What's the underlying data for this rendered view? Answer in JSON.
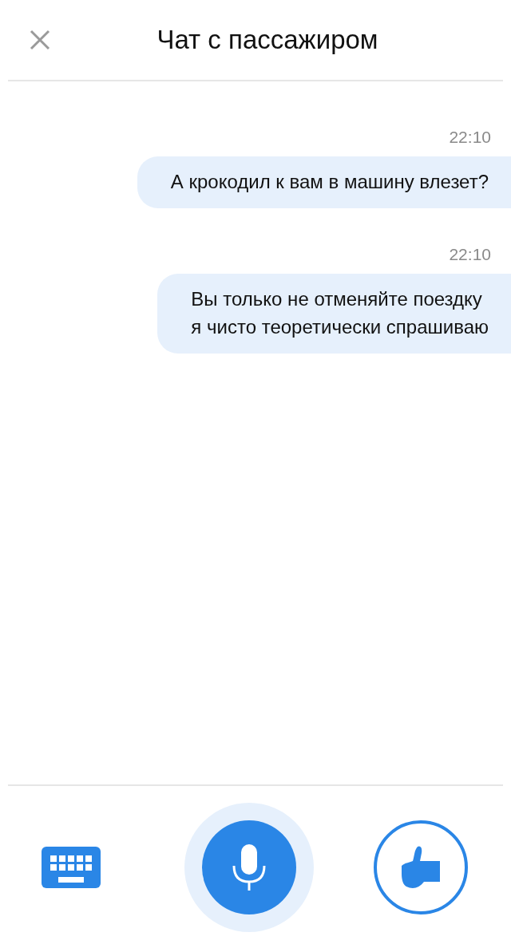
{
  "header": {
    "title": "Чат с пассажиром"
  },
  "messages": [
    {
      "time": "22:10",
      "lines": [
        "А крокодил к вам в машину влезет?"
      ]
    },
    {
      "time": "22:10",
      "lines": [
        "Вы только не отменяйте поездку",
        "я чисто теоретически спрашиваю"
      ]
    }
  ]
}
